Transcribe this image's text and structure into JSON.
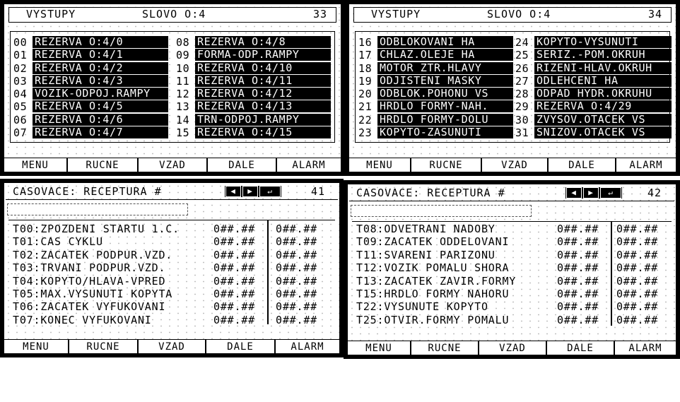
{
  "menu": [
    "MENU",
    "RUCNE",
    "VZAD",
    "DALE",
    "ALARM"
  ],
  "outputs_panels": [
    {
      "title": "VYSTUPY",
      "word": "SLOVO O:4",
      "screen_no": "33",
      "left_rows": [
        {
          "num": "00",
          "label": "REZERVA O:4/0"
        },
        {
          "num": "01",
          "label": "REZERVA O:4/1"
        },
        {
          "num": "02",
          "label": "REZERVA O:4/2"
        },
        {
          "num": "03",
          "label": "REZERVA O:4/3"
        },
        {
          "num": "04",
          "label": "VOZIK-ODPOJ.RAMPY"
        },
        {
          "num": "05",
          "label": "REZERVA O:4/5"
        },
        {
          "num": "06",
          "label": "REZERVA O:4/6"
        },
        {
          "num": "07",
          "label": "REZERVA O:4/7"
        }
      ],
      "right_rows": [
        {
          "num": "08",
          "label": "REZERVA O:4/8"
        },
        {
          "num": "09",
          "label": "FORMA-ODP.RAMPY"
        },
        {
          "num": "10",
          "label": "REZERVA O:4/10"
        },
        {
          "num": "11",
          "label": "REZERVA O:4/11"
        },
        {
          "num": "12",
          "label": "REZERVA O:4/12"
        },
        {
          "num": "13",
          "label": "REZERVA O:4/13"
        },
        {
          "num": "14",
          "label": "TRN-ODPOJ.RAMPY"
        },
        {
          "num": "15",
          "label": "REZERVA O:4/15"
        }
      ]
    },
    {
      "title": "VYSTUPY",
      "word": "SLOVO O:4",
      "screen_no": "34",
      "left_rows": [
        {
          "num": "16",
          "label": "ODBLOKOVANI HA"
        },
        {
          "num": "17",
          "label": "CHLAZ.OLEJE HA"
        },
        {
          "num": "18",
          "label": "MOTOR ZTR.HLAVY"
        },
        {
          "num": "19",
          "label": "ODJISTENI MASKY"
        },
        {
          "num": "20",
          "label": "ODBLOK.POHONU VS"
        },
        {
          "num": "21",
          "label": "HRDLO FORMY-NAH."
        },
        {
          "num": "22",
          "label": "HRDLO FORMY-DOLU"
        },
        {
          "num": "23",
          "label": "KOPYTO-ZASUNUTI"
        }
      ],
      "right_rows": [
        {
          "num": "24",
          "label": "KOPYTO-VYSUNUTI"
        },
        {
          "num": "25",
          "label": "SERIZ.-POM.OKRUH"
        },
        {
          "num": "26",
          "label": "RIZENI-HLAV.OKRUH"
        },
        {
          "num": "27",
          "label": "ODLEHCENI HA"
        },
        {
          "num": "28",
          "label": "ODPAD HYDR.OKRUHU"
        },
        {
          "num": "29",
          "label": "REZERVA O:4/29"
        },
        {
          "num": "30",
          "label": "ZVYSOV.OTACEK VS"
        },
        {
          "num": "31",
          "label": "SNIZOV.OTACEK VS"
        }
      ]
    }
  ],
  "timer_panels": [
    {
      "title": "CASOVACE: RECEPTURA #",
      "screen_no": "41",
      "nav": [
        "◀",
        "▶",
        "↵"
      ],
      "rows": [
        {
          "name": "T00:ZPOZDENI STARTU 1.C.",
          "v1": "0##.##",
          "v2": "0##.##"
        },
        {
          "name": "T01:CAS CYKLU",
          "v1": "0##.##",
          "v2": "0##.##"
        },
        {
          "name": "T02:ZACATEK PODPUR.VZD.",
          "v1": "0##.##",
          "v2": "0##.##"
        },
        {
          "name": "T03:TRVANI PODPUR.VZD.",
          "v1": "0##.##",
          "v2": "0##.##"
        },
        {
          "name": "T04:KOPYTO/HLAVA-VPRED",
          "v1": "0##.##",
          "v2": "0##.##"
        },
        {
          "name": "T05:MAX.VYSUNUTI KOPYTA",
          "v1": "0##.##",
          "v2": "0##.##"
        },
        {
          "name": "T06:ZACATEK VYFUKOVANI",
          "v1": "0##.##",
          "v2": "0##.##"
        },
        {
          "name": "T07:KONEC VYFUKOVANI",
          "v1": "0##.##",
          "v2": "0##.##"
        }
      ]
    },
    {
      "title": "CASOVACE: RECEPTURA #",
      "screen_no": "42",
      "nav": [
        "◀",
        "▶",
        "↵"
      ],
      "rows": [
        {
          "name": "T08:ODVETRANI NADOBY",
          "v1": "0##.##",
          "v2": "0##.##"
        },
        {
          "name": "T09:ZACATEK ODDELOVANI",
          "v1": "0##.##",
          "v2": "0##.##"
        },
        {
          "name": "T11:SVARENI PARIZONU",
          "v1": "0##.##",
          "v2": "0##.##"
        },
        {
          "name": "T12:VOZIK POMALU SHORA",
          "v1": "0##.##",
          "v2": "0##.##"
        },
        {
          "name": "T13:ZACATEK ZAVIR.FORMY",
          "v1": "0##.##",
          "v2": "0##.##"
        },
        {
          "name": "T15:HRDLO FORMY NAHORU",
          "v1": "0##.##",
          "v2": "0##.##"
        },
        {
          "name": "T22:VYSUNUTE KOPYTO",
          "v1": "0##.##",
          "v2": "0##.##"
        },
        {
          "name": "T25:OTVIR.FORMY POMALU",
          "v1": "0##.##",
          "v2": "0##.##"
        }
      ]
    }
  ]
}
